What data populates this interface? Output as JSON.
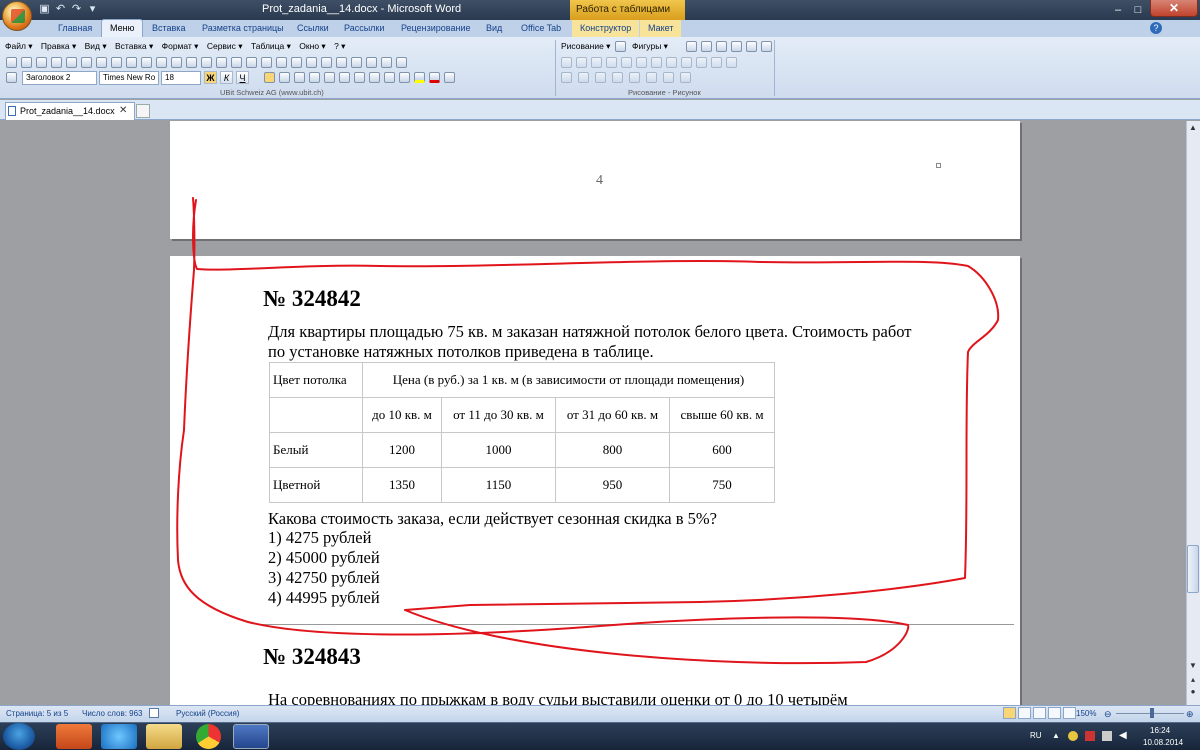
{
  "window": {
    "title": "Prot_zadania__14.docx - Microsoft Word",
    "context_tab_group": "Работа с таблицами",
    "buttons": {
      "minimize": "–",
      "maximize": "□",
      "close": "✕"
    }
  },
  "ribbon": {
    "tabs": [
      "Главная",
      "Меню",
      "Вставка",
      "Разметка страницы",
      "Ссылки",
      "Рассылки",
      "Рецензирование",
      "Вид",
      "Office Tab",
      "Конструктор",
      "Макет"
    ],
    "active_tab": "Меню",
    "menu_items": [
      "Файл ▾",
      "Правка ▾",
      "Вид ▾",
      "Вставка ▾",
      "Формат ▾",
      "Сервис ▾",
      "Таблица ▾",
      "Окно ▾",
      "? ▾"
    ],
    "style_value": "Заголовок 2",
    "font_value": "Times New Ro",
    "size_value": "18",
    "bold": "Ж",
    "italic": "К",
    "underline": "Ч",
    "toolbar_caption": "UBit Schweiz AG   (www.ubit.ch)",
    "drawing_label": "Рисование ▾",
    "shapes_label": "Фигуры ▾",
    "drawing_caption": "Рисование - Рисунок"
  },
  "doc_tab": {
    "label": "Prot_zadania__14.docx"
  },
  "page1": {
    "page_number": "4"
  },
  "task1": {
    "title": "№ 324842",
    "text": "Для квартиры площадью 75 кв. м заказан натяжной потолок белого цвета. Стоимость работ по установке натяжных потолков приведена в таблице.",
    "table": {
      "col_header": "Цвет потолка",
      "price_header": "Цена (в руб.) за 1 кв. м (в зависимости от площади помещения)",
      "ranges": [
        "до 10 кв. м",
        "от 11 до 30 кв. м",
        "от 31 до 60 кв. м",
        "свыше 60 кв. м"
      ],
      "rows": [
        {
          "color": "Белый",
          "prices": [
            "1200",
            "1000",
            "800",
            "600"
          ]
        },
        {
          "color": "Цветной",
          "prices": [
            "1350",
            "1150",
            "950",
            "750"
          ]
        }
      ]
    },
    "question": "Какова стоимость заказа, если действует сезонная скидка в 5%?",
    "answers": [
      "1) 4275 рублей",
      "2) 45000 рублей",
      "3) 42750 рублей",
      "4) 44995 рублей"
    ]
  },
  "task2": {
    "title": "№ 324843",
    "text": "На соревнованиях по прыжкам в воду судьи выставили оценки от 0 до 10 четырём"
  },
  "statusbar": {
    "page": "Страница: 5 из 5",
    "words": "Число слов: 963",
    "language": "Русский (Россия)",
    "zoom": "150%"
  },
  "taskbar": {
    "lang": "RU",
    "time": "16:24",
    "date": "10.08.2014"
  },
  "annotation_color": "#e0151b"
}
